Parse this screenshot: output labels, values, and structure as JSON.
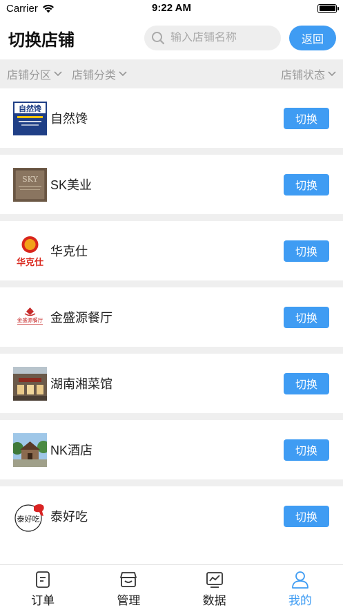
{
  "status_bar": {
    "carrier": "Carrier",
    "time": "9:22 AM"
  },
  "header": {
    "title": "切换店铺",
    "search_placeholder": "输入店铺名称",
    "back_label": "返回"
  },
  "filters": {
    "zone": "店铺分区",
    "category": "店铺分类",
    "status": "店铺状态"
  },
  "stores": [
    {
      "name": "自然馋",
      "logo": "zirancan-logo",
      "logo_text": "自然馋",
      "switch_label": "切换"
    },
    {
      "name": "SK美业",
      "logo": "sk-logo",
      "logo_text": "SKY",
      "switch_label": "切换"
    },
    {
      "name": "华克仕",
      "logo": "huakeshi-logo",
      "logo_text": "华克仕",
      "switch_label": "切换"
    },
    {
      "name": "金盛源餐厅",
      "logo": "jinshengyuan-logo",
      "logo_text": "金盛源餐厅",
      "switch_label": "切换"
    },
    {
      "name": "湖南湘菜馆",
      "logo": "hunan-photo",
      "switch_label": "切换"
    },
    {
      "name": "NK酒店",
      "logo": "nk-photo",
      "switch_label": "切换"
    },
    {
      "name": "泰好吃",
      "logo": "taihaochi-logo",
      "logo_text": "泰好吃",
      "switch_label": "切换"
    }
  ],
  "tabs": [
    {
      "label": "订单",
      "icon": "order-icon",
      "active": false
    },
    {
      "label": "管理",
      "icon": "manage-icon",
      "active": false
    },
    {
      "label": "数据",
      "icon": "data-icon",
      "active": false
    },
    {
      "label": "我的",
      "icon": "profile-icon",
      "active": true
    }
  ],
  "colors": {
    "accent": "#3f9cf3",
    "filter_bg": "#eeeeee",
    "divider": "#efefef"
  }
}
